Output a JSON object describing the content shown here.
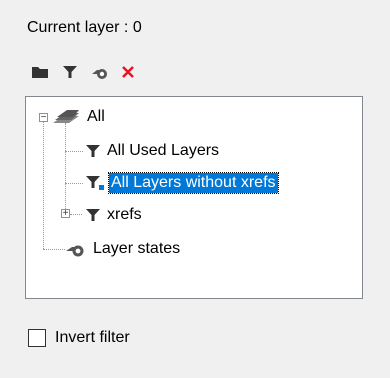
{
  "header": {
    "current_layer_text": "Current layer : 0"
  },
  "toolbar": {
    "buttons": [
      {
        "name": "folder-icon",
        "color": "#333333"
      },
      {
        "name": "filter-icon",
        "color": "#333333"
      },
      {
        "name": "layer-state-icon",
        "color": "#555555"
      },
      {
        "name": "delete-icon",
        "color": "#e81123"
      }
    ]
  },
  "tree": {
    "root": {
      "label": "All",
      "icon": "layers-stack-icon",
      "expanded": true,
      "children": [
        {
          "label": "All Used Layers",
          "icon": "filter-icon"
        },
        {
          "label": "All Layers without xrefs",
          "icon": "filter-icon",
          "selected": true
        },
        {
          "label": "xrefs",
          "icon": "filter-icon",
          "expanded": false
        }
      ]
    },
    "layer_states": {
      "label": "Layer states",
      "icon": "layer-state-icon"
    }
  },
  "invert_filter": {
    "label": "Invert filter",
    "checked": false
  },
  "colors": {
    "selection": "#0078d7",
    "accent_square": "#0078d7",
    "delete": "#e81123"
  }
}
